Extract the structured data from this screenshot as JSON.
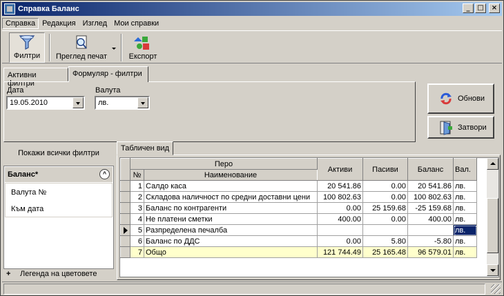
{
  "window": {
    "title": "Справка Баланс"
  },
  "menu": [
    "Справка",
    "Редакция",
    "Изглед",
    "Мои справки"
  ],
  "toolbar": {
    "filters": "Филтри",
    "print_preview": "Преглед печат",
    "export": "Експорт"
  },
  "tabs": {
    "active_filters": "Активни филтри",
    "form_filters": "Формуляр - филтри"
  },
  "filters": {
    "date_label": "Дата",
    "date_value": "19.05.2010",
    "currency_label": "Валута",
    "currency_value": "лв."
  },
  "buttons": {
    "refresh": "Обнови",
    "close": "Затвори"
  },
  "left": {
    "show_all": "Покажи всички филтри",
    "group_title": "Баланс*",
    "items": [
      "Валута №",
      "Към дата"
    ],
    "legend": "Легенда на цветовете"
  },
  "grid": {
    "tab": "Табличен вид",
    "header_group": "Перо",
    "headers": {
      "no": "№",
      "name": "Наименование",
      "assets": "Активи",
      "liabilities": "Пасиви",
      "balance": "Баланс",
      "currency": "Вал."
    },
    "rows": [
      {
        "no": "1",
        "name": "Салдо каса",
        "assets": "20 541.86",
        "liabilities": "0.00",
        "balance": "20 541.86",
        "currency": "лв."
      },
      {
        "no": "2",
        "name": "Складова наличност по средни доставни цени",
        "assets": "100 802.63",
        "liabilities": "0.00",
        "balance": "100 802.63",
        "currency": "лв."
      },
      {
        "no": "3",
        "name": "Баланс по контрагенти",
        "assets": "0.00",
        "liabilities": "25 159.68",
        "balance": "-25 159.68",
        "currency": "лв."
      },
      {
        "no": "4",
        "name": "Не платени сметки",
        "assets": "400.00",
        "liabilities": "0.00",
        "balance": "400.00",
        "currency": "лв."
      },
      {
        "no": "5",
        "name": "Разпределена печалба",
        "assets": "",
        "liabilities": "",
        "balance": "",
        "currency": "лв."
      },
      {
        "no": "6",
        "name": "Баланс по ДДС",
        "assets": "0.00",
        "liabilities": "5.80",
        "balance": "-5.80",
        "currency": "лв."
      },
      {
        "no": "7",
        "name": "Общо",
        "assets": "121 744.49",
        "liabilities": "25 165.48",
        "balance": "96 579.01",
        "currency": "лв."
      }
    ]
  }
}
